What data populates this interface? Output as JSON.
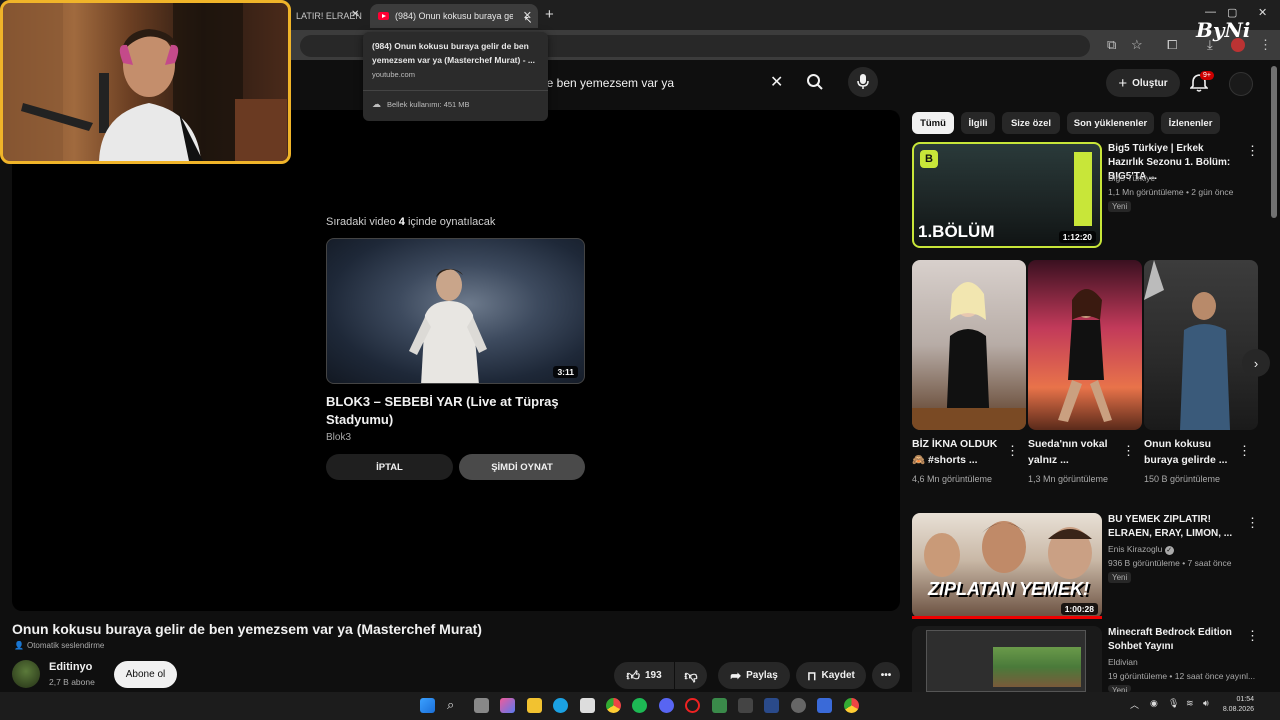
{
  "browser": {
    "tabs": [
      {
        "label": "LATIR! ELRAEN",
        "active": false
      },
      {
        "label": "(984) Onun kokusu buraya gelir de",
        "active": true
      }
    ],
    "hovercard": {
      "title": "(984) Onun kokusu buraya gelir de ben yemezsem var ya (Masterchef Murat) - ...",
      "domain": "youtube.com",
      "memory": "Bellek kullanımı: 451 MB"
    }
  },
  "header": {
    "search_text": "de ben yemezsem var ya",
    "create_label": "Oluştur",
    "notification_badge": "9+"
  },
  "player": {
    "upnext_prefix": "Sıradaki video ",
    "upnext_count": "4",
    "upnext_suffix": " içinde oynatılacak",
    "upnext_title": "BLOK3 – SEBEBİ YAR (Live at Tüpraş Stadyumu)",
    "upnext_channel": "Blok3",
    "upnext_duration": "3:11",
    "cancel_label": "İPTAL",
    "playnow_label": "ŞİMDİ OYNAT"
  },
  "video": {
    "title": "Onun kokusu buraya gelir de ben yemezsem var ya (Masterchef Murat)",
    "dub_label": "Otomatik seslendirme",
    "channel": "Editinyo",
    "subscribers": "2,7 B abone",
    "subscribe_label": "Abone ol",
    "likes": "193",
    "share_label": "Paylaş",
    "save_label": "Kaydet"
  },
  "chips": [
    "Tümü",
    "İlgili",
    "Size özel",
    "Son yüklenenler",
    "İzlenenler"
  ],
  "sidebar": {
    "top_video": {
      "title": "Big5 Türkiye | Erkek Hazırlık Sezonu 1. Bölüm: BIG5'TA ...",
      "channel": "Big5 Türkiye",
      "meta": "1,1 Mn görüntüleme • 2 gün önce",
      "badge": "Yeni",
      "duration": "1:12:20",
      "thumb_text": "1.BÖLÜM"
    },
    "shorts": [
      {
        "title": "BİZ İKNA OLDUK 🙈 #shorts ...",
        "views": "4,6 Mn görüntüleme"
      },
      {
        "title": "Sueda'nın vokal yalnız ...",
        "views": "1,3 Mn görüntüleme"
      },
      {
        "title": "Onun kokusu buraya gelirde ...",
        "views": "150 B görüntüleme"
      }
    ],
    "video2": {
      "title": "BU YEMEK ZIPLATIR! ELRAEN, ERAY, LIMON, ...",
      "channel": "Enis Kirazoglu",
      "meta": "936 B görüntüleme • 7 saat önce",
      "badge": "Yeni",
      "duration": "1:00:28",
      "thumb_text": "ZIPLATAN YEMEK!"
    },
    "video3": {
      "title": "Minecraft Bedrock Edition Sohbet Yayını",
      "channel": "Eldivian",
      "meta": "19 görüntüleme • 12 saat önce yayınl...",
      "badge": "Yeni"
    }
  },
  "overlay_logo": "ByNi",
  "taskbar": {
    "time": "01:54",
    "date": "8.08.2026"
  },
  "colors": {
    "accent_red": "#ff0033",
    "webcam_border": "#f0b429",
    "background": "#0f0f0f"
  }
}
